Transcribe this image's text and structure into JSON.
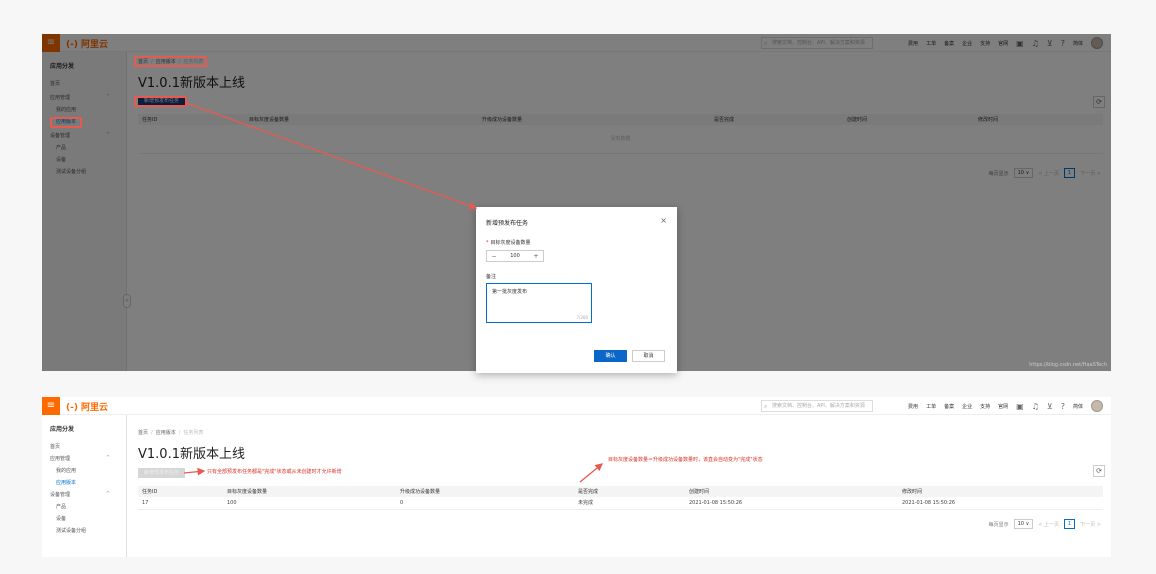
{
  "app": {
    "menu_icon": "≡",
    "logo_bracket": "(-)",
    "logo_text": "阿里云",
    "search_placeholder": "搜索文档、控制台、API、解决方案和资源",
    "top_links": [
      "费用",
      "工单",
      "备案",
      "企业",
      "支持",
      "官网"
    ],
    "top_icons": [
      "terminal-icon",
      "bell-icon",
      "cart-icon",
      "help-icon"
    ],
    "lang": "简体"
  },
  "sidebar": {
    "title": "应用分发",
    "items": [
      {
        "label": "首页",
        "level": 0
      },
      {
        "label": "应用管理",
        "level": 0,
        "chevron": "^"
      },
      {
        "label": "我的应用",
        "level": 1
      },
      {
        "label": "应用版本",
        "level": 1,
        "active": true
      },
      {
        "label": "设备管理",
        "level": 0,
        "chevron": "^"
      },
      {
        "label": "产品",
        "level": 1
      },
      {
        "label": "设备",
        "level": 1
      },
      {
        "label": "测试设备分组",
        "level": 1
      }
    ],
    "collapse_icon": "<"
  },
  "main": {
    "breadcrumb": [
      "首页",
      "应用版本",
      "任务列表"
    ],
    "title": "V1.0.1新版本上线",
    "new_task_button": "新增预发布任务",
    "refresh_icon": "⟳",
    "columns_top": [
      "任务ID",
      "目标灰度设备数量",
      "升级成功设备数量",
      "是否完成",
      "创建时间",
      "修改时间"
    ],
    "columns_bottom": [
      "任务ID",
      "目标灰度设备数量",
      "升级成功设备数量",
      "是否完成",
      "创建时间",
      "修改时间"
    ],
    "empty_text": "没有数据",
    "rows": [
      {
        "id": "17",
        "target": "100",
        "success": "0",
        "done": "未完成",
        "created": "2021-01-08 15:50:26",
        "modified": "2021-01-08 15:50:26"
      }
    ],
    "pager": {
      "page_size_label": "每页显示",
      "page_size": "10",
      "prev": "< 上一页",
      "page": "1",
      "next": "下一页 >"
    }
  },
  "dialog": {
    "title": "新增预发布任务",
    "close_icon": "×",
    "target_label": "目标灰度设备数量",
    "required_mark": "*",
    "stepper_minus": "−",
    "stepper_value": "100",
    "stepper_plus": "+",
    "remark_label": "备注",
    "remark_value": "第一批灰度发布",
    "remark_count": "7/300",
    "ok": "确认",
    "cancel": "取消"
  },
  "annotations": {
    "note_left": "只有全部预发布任务都是\"完成\"状态或从未创建时才允许新增",
    "note_right": "目标灰度设备数量＝升级成功设备数量时，该直会自动变为\"完成\"状态",
    "watermark": "https://blog.csdn.net/HaaSTech"
  },
  "colors": {
    "brand": "#ff6a00",
    "primary": "#0a67c9",
    "annotation": "#e85a4f"
  }
}
